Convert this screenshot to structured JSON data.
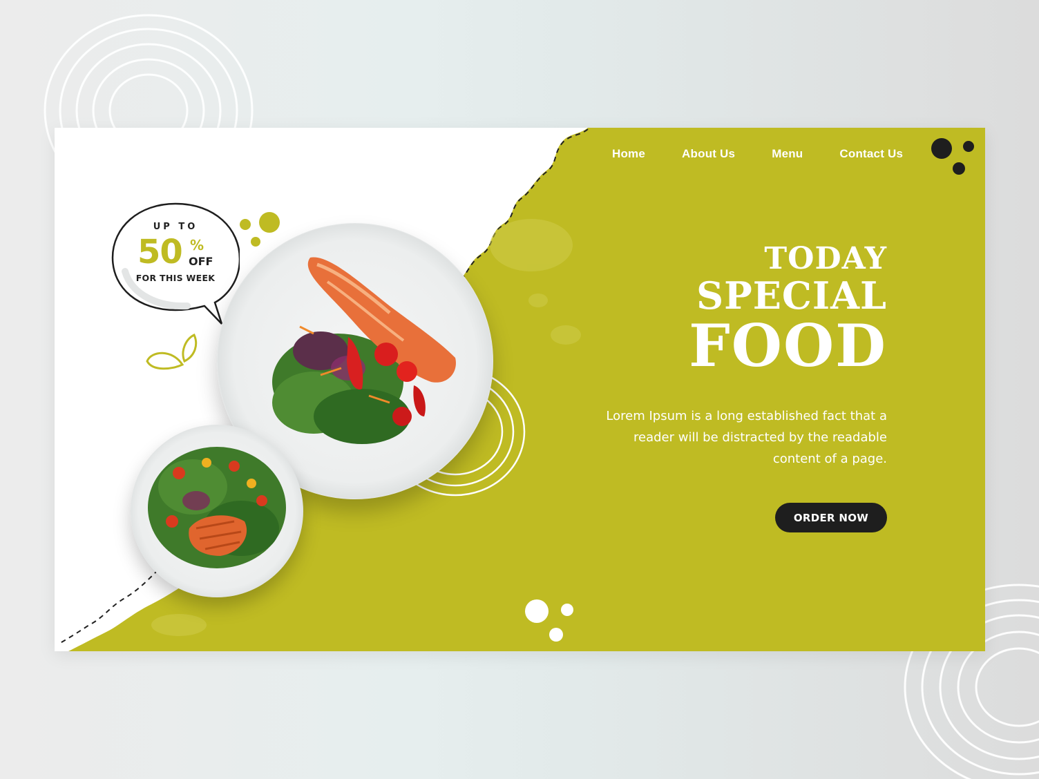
{
  "nav": {
    "items": [
      {
        "label": "Home"
      },
      {
        "label": "About Us"
      },
      {
        "label": "Menu"
      },
      {
        "label": "Contact Us"
      }
    ]
  },
  "promo": {
    "line1": "UP TO",
    "percent": "50",
    "percent_sign": "%",
    "off": "OFF",
    "line3": "FOR THIS WEEK"
  },
  "hero": {
    "title_line1": "TODAY",
    "title_line2": "SPECIAL",
    "title_line3": "FOOD",
    "description": "Lorem Ipsum is a long established fact that a reader will be distracted by the readable content of a page.",
    "cta_label": "ORDER NOW"
  },
  "colors": {
    "accent": "#bfbb23",
    "dark": "#1e1e1e",
    "background": "#ececec",
    "card": "#ffffff"
  },
  "icons": {
    "top_dots": "dots-cluster-icon",
    "bottom_dots": "dots-cluster-icon",
    "scribble": "scribble-circle-icon",
    "leaf": "leaf-doodle-icon"
  }
}
